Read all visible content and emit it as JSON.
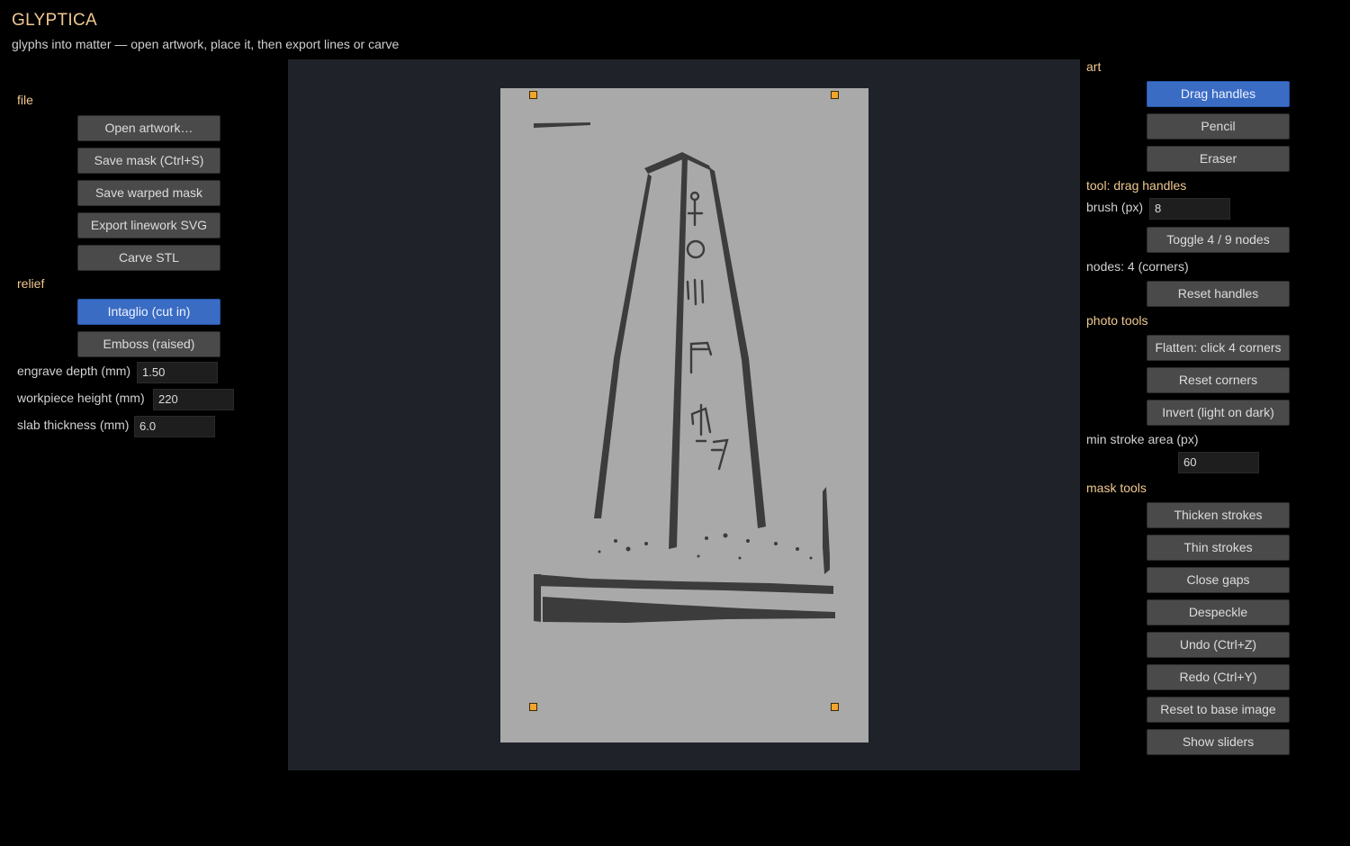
{
  "app": {
    "title": "GLYPTICA",
    "subtitle": "glyphs into matter — open artwork, place it, then export lines or carve"
  },
  "left": {
    "file_label": "file",
    "file_buttons": [
      "Open artwork…",
      "Save mask (Ctrl+S)",
      "Save warped mask",
      "Export linework SVG",
      "Carve STL"
    ],
    "relief_label": "relief",
    "relief_buttons": [
      "Intaglio (cut in)",
      "Emboss (raised)"
    ],
    "fields": [
      {
        "label": "engrave depth (mm)",
        "value": "1.50"
      },
      {
        "label": "workpiece height (mm)",
        "value": "220"
      },
      {
        "label": "slab thickness (mm)",
        "value": "6.0"
      }
    ]
  },
  "right": {
    "art_label": "art",
    "art_buttons": [
      "Drag handles",
      "Pencil",
      "Eraser"
    ],
    "tool_status": "tool: drag handles",
    "brush_label": "brush (px)",
    "brush_value": "8",
    "toggle_nodes": "Toggle 4 / 9 nodes",
    "nodes_status": "nodes: 4 (corners)",
    "reset_handles": "Reset handles",
    "photo_label": "photo tools",
    "photo_buttons": [
      "Flatten: click 4 corners",
      "Reset corners",
      "Invert (light on dark)"
    ],
    "min_stroke_label": "min stroke area (px)",
    "min_stroke_value": "60",
    "mask_label": "mask tools",
    "mask_buttons": [
      "Thicken strokes",
      "Thin strokes",
      "Close gaps",
      "Despeckle",
      "Undo (Ctrl+Z)",
      "Redo (Ctrl+Y)",
      "Reset to base image",
      "Show sliders"
    ]
  },
  "colors": {
    "accent": "#3b6cc4",
    "section_header": "#f0c890",
    "handle": "#f2a52c",
    "canvas": "#1f2329",
    "artwork_bg": "#a9a9a9",
    "ink": "#3c3c3c"
  }
}
